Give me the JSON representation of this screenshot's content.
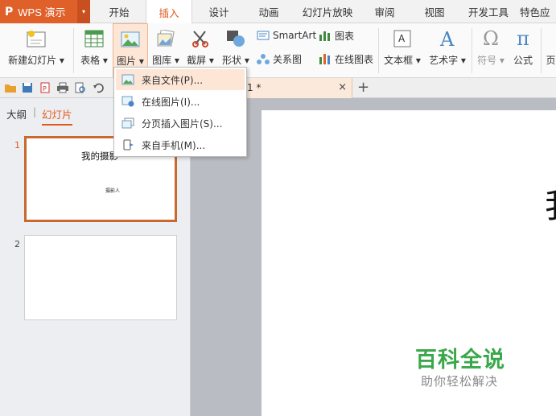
{
  "app": {
    "logo": "P",
    "title": "WPS 演示",
    "caret": "▾"
  },
  "tabs": [
    {
      "label": "开始"
    },
    {
      "label": "插入"
    },
    {
      "label": "设计"
    },
    {
      "label": "动画"
    },
    {
      "label": "幻灯片放映"
    },
    {
      "label": "审阅"
    },
    {
      "label": "视图"
    },
    {
      "label": "开发工具"
    },
    {
      "label": "特色应"
    }
  ],
  "active_tab": "插入",
  "ribbon": {
    "new_slide": "新建幻灯片",
    "table": "表格",
    "picture": "图片",
    "gallery": "图库",
    "screenshot": "截屏",
    "shapes": "形状",
    "smartart": "SmartArt",
    "chart": "图表",
    "relation": "关系图",
    "online_chart": "在线图表",
    "textbox": "文本框",
    "wordart": "艺术字",
    "symbol": "符号",
    "formula": "公式",
    "more": "页"
  },
  "doc_tab": {
    "name": "1 *",
    "close": "×",
    "new": "+"
  },
  "picture_menu": [
    {
      "label": "来自文件(P)..."
    },
    {
      "label": "在线图片(I)..."
    },
    {
      "label": "分页插入图片(S)..."
    },
    {
      "label": "来自手机(M)..."
    }
  ],
  "panel": {
    "outline_tab": "大纲",
    "slides_tab": "幻灯片",
    "sep": "|"
  },
  "slides": [
    {
      "number": "1",
      "title": "我的摄影",
      "subtitle": "摄影人"
    },
    {
      "number": "2"
    }
  ],
  "canvas": {
    "big_text": "我"
  },
  "watermark": {
    "title": "百科全说",
    "subtitle": "助你轻松解决"
  },
  "colors": {
    "accent": "#e05a1f",
    "menu_hover": "#fde6d6",
    "watermark_green": "#3aa84a"
  }
}
